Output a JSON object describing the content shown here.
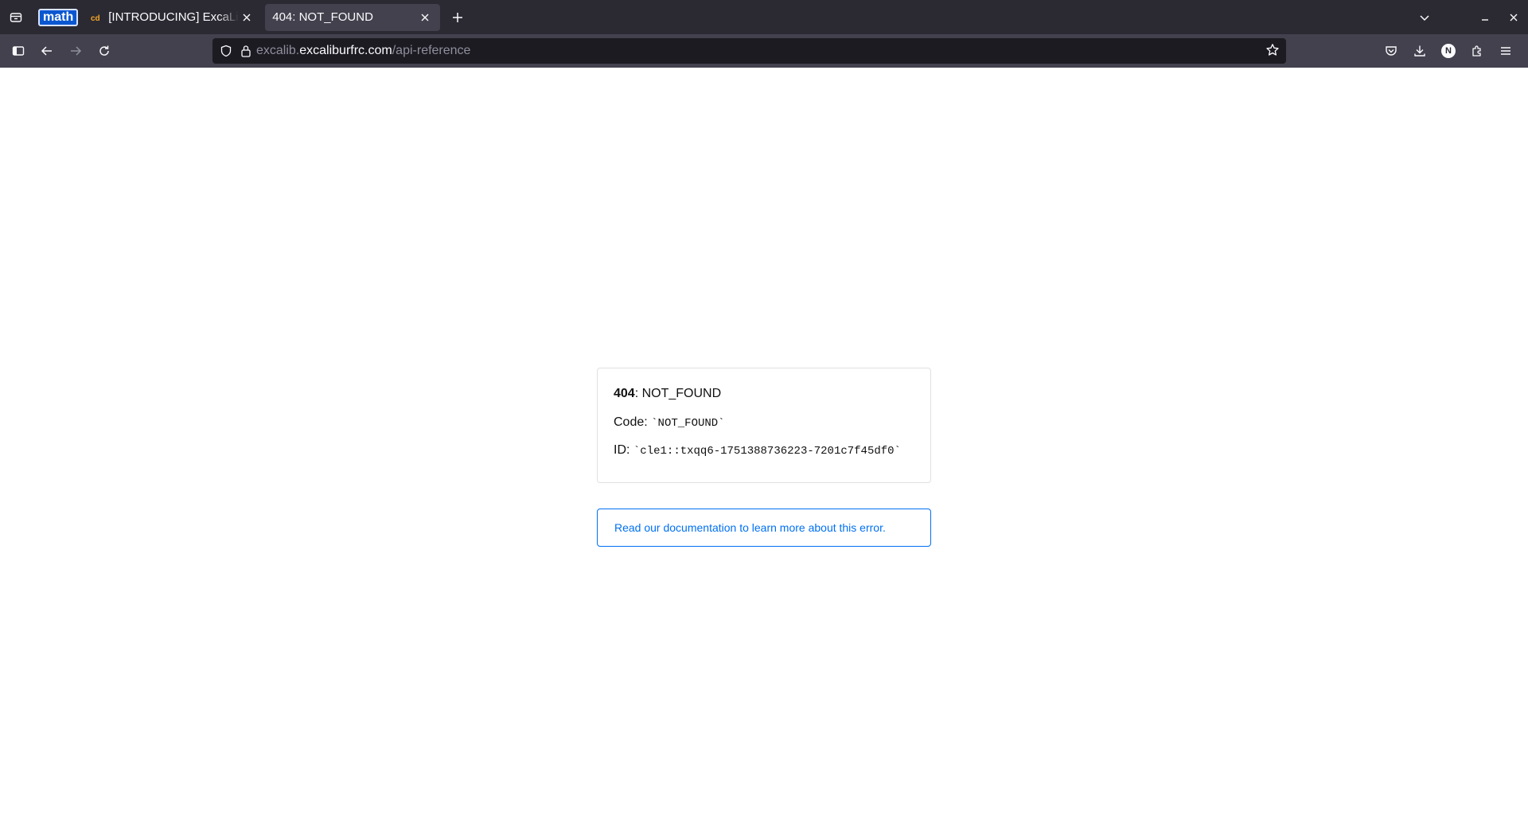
{
  "browser": {
    "pinned_tab": {
      "label": "math"
    },
    "tabs": [
      {
        "title": "[INTRODUCING] ExcaLib",
        "favicon": "cd",
        "active": false
      },
      {
        "title": "404: NOT_FOUND",
        "active": true
      }
    ],
    "url": {
      "prefix": "excalib.",
      "domain": "excaliburfrc.com",
      "path": "/api-reference"
    },
    "profile_initial": "N"
  },
  "page": {
    "error_code": "404",
    "error_title": "NOT_FOUND",
    "code_label": "Code:",
    "code_value": "`NOT_FOUND`",
    "id_label": "ID:",
    "id_value": "`cle1::txqq6-1751388736223-7201c7f45df0`",
    "doc_link": "Read our documentation to learn more about this error."
  },
  "colors": {
    "tabbar_bg": "#2b2a33",
    "navbar_bg": "#42414d",
    "urlbar_bg": "#1c1b22",
    "link": "#0070f3"
  }
}
